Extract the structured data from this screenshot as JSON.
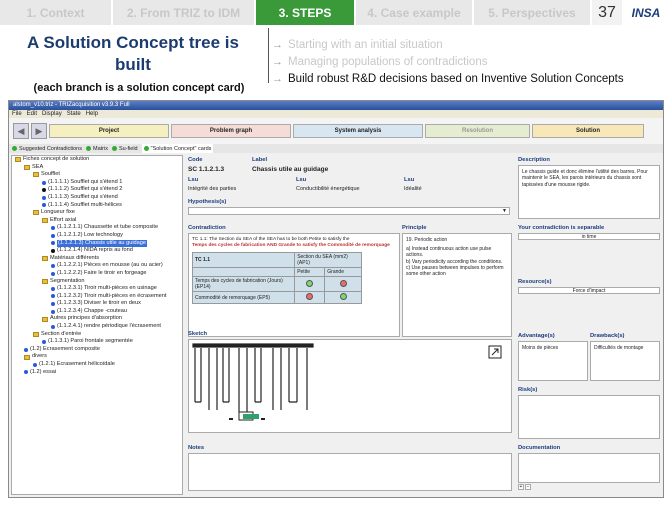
{
  "topnav": {
    "tabs": [
      "1. Context",
      "2. From TRIZ to IDM",
      "3. STEPS",
      "4. Case example",
      "5. Perspectives"
    ],
    "page_number": "37",
    "logo": "INSA"
  },
  "slide": {
    "title": "A Solution Concept tree is built",
    "subtitle": "(each branch is a solution concept card)",
    "bullets": [
      "Starting with an initial situation",
      "Managing populations of contradictions",
      "Build robust R&D decisions based on Inventive Solution Concepts"
    ]
  },
  "app": {
    "window_title": "alstom_v10.triz - TRIZacquisition v3.9.3 Full",
    "menu": [
      "File",
      "Edit",
      "Display",
      "State",
      "Help"
    ],
    "steps": [
      "Project",
      "Problem graph",
      "System analysis",
      "Resolution",
      "Solution"
    ],
    "tabs": [
      "Suggested Contradictions",
      "Matrix",
      "Su-field",
      "\"Solution Concept\" cards"
    ],
    "tree": [
      {
        "label": "Fiches concept de solution",
        "level": 0,
        "kind": "folder"
      },
      {
        "label": "SEA",
        "level": 1,
        "kind": "folder"
      },
      {
        "label": "Soufflet",
        "level": 2,
        "kind": "folder"
      },
      {
        "label": "(1.1.1.1) Soufflet qui s'étend 1",
        "level": 3,
        "kind": "blue"
      },
      {
        "label": "(1.1.1.2) Soufflet qui s'étend 2",
        "level": 3,
        "kind": "black"
      },
      {
        "label": "(1.1.1.3) Soufflet qui s'étend",
        "level": 3,
        "kind": "blue"
      },
      {
        "label": "(1.1.1.4) Soufflet multi-hélices",
        "level": 3,
        "kind": "blue"
      },
      {
        "label": "Longueur fixe",
        "level": 2,
        "kind": "folder"
      },
      {
        "label": "Effort axial",
        "level": 3,
        "kind": "folder"
      },
      {
        "label": "(1.1.2.1.1) Chaussette et tube composite",
        "level": 4,
        "kind": "blue"
      },
      {
        "label": "(1.1.2.1.2) Low technology",
        "level": 4,
        "kind": "blue"
      },
      {
        "label": "(1.1.2.1.3) Chassis utile au guidage",
        "level": 4,
        "kind": "blue",
        "selected": true
      },
      {
        "label": "(1.1.2.1.4) NIDA repris au fond",
        "level": 4,
        "kind": "black"
      },
      {
        "label": "Matériaux différents",
        "level": 3,
        "kind": "folder"
      },
      {
        "label": "(1.1.2.2.1) Pièces en mousse (au ou acier)",
        "level": 4,
        "kind": "blue"
      },
      {
        "label": "(1.1.2.2.2) Faire le tiroir en forgeage",
        "level": 4,
        "kind": "blue"
      },
      {
        "label": "Segmentation",
        "level": 3,
        "kind": "folder"
      },
      {
        "label": "(1.1.2.3.1) Tiroir multi-pièces en usinage",
        "level": 4,
        "kind": "blue"
      },
      {
        "label": "(1.1.2.3.2) Tiroir multi-pièces en écrasement",
        "level": 4,
        "kind": "blue"
      },
      {
        "label": "(1.1.2.3.3) Diviser le tiroir en deux",
        "level": 4,
        "kind": "blue"
      },
      {
        "label": "(1.1.2.3.4) Chappe -couteau",
        "level": 4,
        "kind": "blue"
      },
      {
        "label": "Autres principes d'absorption",
        "level": 3,
        "kind": "folder"
      },
      {
        "label": "(1.1.2.4.1) rendre périodique l'écrasement",
        "level": 4,
        "kind": "blue"
      },
      {
        "label": "Section d'entrée",
        "level": 2,
        "kind": "folder"
      },
      {
        "label": "(1.1.3.1) Paroi frontale segmentée",
        "level": 3,
        "kind": "blue"
      },
      {
        "label": "(1.2) Ecrasement composite",
        "level": 1,
        "kind": "blue"
      },
      {
        "label": "divers",
        "level": 1,
        "kind": "folder"
      },
      {
        "label": "(1.2.1) Ecrasement hélicoïdale",
        "level": 2,
        "kind": "blue"
      },
      {
        "label": "(1.2) essai",
        "level": 1,
        "kind": "blue"
      }
    ],
    "card": {
      "code_label": "Code",
      "code": "SC 1.1.2.1.3",
      "name_label": "Label",
      "name": "Chassis utile au guidage",
      "params": [
        {
          "header": "Lsu",
          "value": "Intégrité des parties"
        },
        {
          "header": "Lsu",
          "value": "Conductibilité énergétique"
        },
        {
          "header": "Lsu",
          "value": "Idéalité"
        }
      ],
      "hypothesis_label": "Hypothesis(s)",
      "contradiction_label": "Contradiction",
      "contradiction_text_a": "TC 1.1: The Section du SEA of the SEA has to be both Petite to satisfy the",
      "contradiction_text_b": "Temps des cycles de fabrication AND Grande to satisfy the Commodité de remorquage",
      "table_title": "TC 1.1",
      "table_col_header": "Section du SEA (mm2) (AP1)",
      "col_a": "Petite",
      "col_b": "Grande",
      "row_a": "Temps des cycles de fabrication (Jours) (EP14)",
      "row_b": "Commodité de remorquage (EP5)",
      "principle_label": "Principle",
      "principle_text": "19. Periodic action",
      "principle_items": [
        "a) Instead continuous action use pulse actions.",
        "b) Vary periodicity according the conditions.",
        "c) Use pauses between impulses to perform some other action"
      ],
      "description_label": "Description",
      "description_text": "Le chassis guide et donc élimine l'utilité des barres. Pour maintenir le SEA, les parois intérieurs du chassis sont tapissées d'une mousse rigide.",
      "separable_label": "Your contradiction is separable",
      "separable_value": "in time",
      "resources_label": "Resource(s)",
      "resource_value": "Force d'impact",
      "advantage_label": "Advantage(s)",
      "advantage_value": "Moins de pièces",
      "drawback_label": "Drawback(s)",
      "drawback_value": "Difficultés de montage",
      "risk_label": "Risk(s)",
      "sketch_label": "Sketch",
      "notes_label": "Notes",
      "documentation_label": "Documentation"
    }
  },
  "colors": {
    "active_tab": "#3a9a3a",
    "title": "#1c3c70",
    "tree_blue": "#2a5ad8"
  }
}
